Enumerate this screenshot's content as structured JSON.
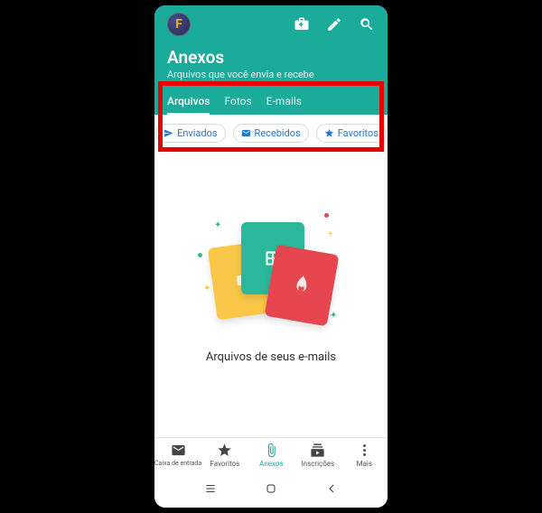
{
  "header": {
    "avatar_letter": "F",
    "title": "Anexos",
    "subtitle": "Arquivos que você envia e recebe"
  },
  "tabs": [
    {
      "label": "Arquivos",
      "active": true
    },
    {
      "label": "Fotos",
      "active": false
    },
    {
      "label": "E-mails",
      "active": false
    }
  ],
  "chips": {
    "sent": "Enviados",
    "received": "Recebidos",
    "favorites": "Favoritos"
  },
  "empty_state": {
    "text": "Arquivos de seus e-mails"
  },
  "bottom_nav": {
    "inbox": "Caixa de entrada",
    "favorites": "Favoritos",
    "attachments": "Anexos",
    "subscriptions": "Inscrições",
    "more": "Mais"
  }
}
